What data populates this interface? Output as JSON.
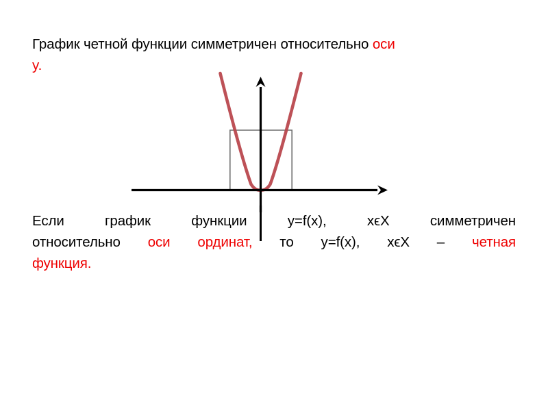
{
  "slide": {
    "background_color": "#ffffff",
    "text_color": "#000000",
    "accent_color": "#ee0000",
    "curve_color": "#b8444a",
    "axis_color": "#000000",
    "construction_line_color": "#808080"
  },
  "top_statement": {
    "line1_black": "График четной функции симметричен относительно ",
    "line1_red": "оси",
    "line2_red": "y."
  },
  "definition": {
    "line1": {
      "segment1": "Если график функции y=f(x), хϵХ симметричен"
    },
    "line2": {
      "segment1": "относительно ",
      "segment2_red": "оси ординат,",
      "segment3": " то y=f(x), хϵХ – ",
      "segment4_red": "четная"
    },
    "line3": {
      "segment1_red": "функция."
    }
  },
  "chart_data": {
    "type": "line",
    "title": "",
    "subtitle": "",
    "xlabel": "",
    "ylabel": "",
    "function": "y = f(x)",
    "curve_label": "parabola",
    "symmetry_axis": "y-axis",
    "vertex": [
      0,
      0
    ],
    "xlim": [
      -2.2,
      2.2
    ],
    "ylim": [
      0,
      9
    ],
    "grid": false,
    "legend": false,
    "series": [
      {
        "name": "y = a x^2",
        "x": [
          -1.45,
          -1.3,
          -1.15,
          -1.0,
          -0.85,
          -0.7,
          -0.55,
          -0.4,
          -0.25,
          -0.1,
          0,
          0.1,
          0.25,
          0.4,
          0.55,
          0.7,
          0.85,
          1.0,
          1.15,
          1.3,
          1.45
        ],
        "y": [
          8.4,
          6.76,
          5.29,
          4.0,
          2.89,
          1.96,
          1.21,
          0.64,
          0.25,
          0.04,
          0,
          0.04,
          0.25,
          0.64,
          1.21,
          1.96,
          2.89,
          4.0,
          5.29,
          6.76,
          8.4
        ]
      }
    ],
    "annotations": [
      {
        "type": "construction-rectangle",
        "description": "thin gray rectangle showing equal f(-x) and f(x) heights",
        "x_left": -0.58,
        "x_right": 0.58,
        "y_top": 1.35,
        "y_bottom": 0
      },
      {
        "type": "axis-arrow",
        "description": "x-axis pointing right"
      },
      {
        "type": "axis-arrow",
        "description": "y-axis pointing up"
      }
    ]
  }
}
